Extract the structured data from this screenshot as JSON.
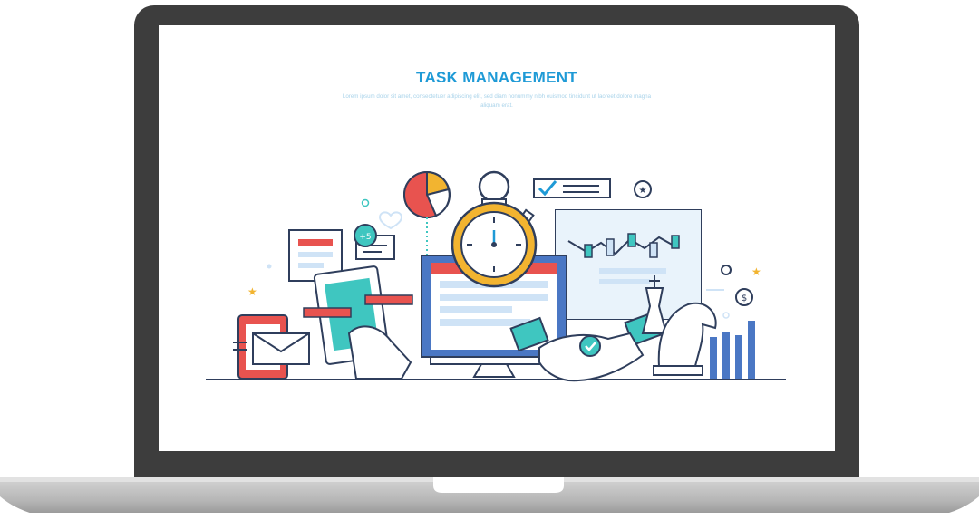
{
  "header": {
    "title": "TASK MANAGEMENT",
    "subtitle": "Lorem ipsum dolor sit amet, consectetuer adipiscing elit, sed diam nonummy nibh euismod tincidunt ut laoreet dolore magna aliquam erat."
  },
  "illustration": {
    "badge_text": "+5",
    "coin_symbol": "$",
    "icons": [
      "laptop-icon",
      "pie-chart-icon",
      "stopwatch-icon",
      "checklist-icon",
      "star-icon",
      "document-icon",
      "chat-bubble-icon",
      "tablet-icon",
      "phone-icon",
      "envelope-icon",
      "monitor-icon",
      "stock-chart-icon",
      "handshake-icon",
      "chess-knight-icon",
      "chess-king-icon",
      "bar-chart-icon",
      "dollar-coin-icon",
      "heart-icon"
    ]
  },
  "colors": {
    "bezel": "#3d3d3d",
    "base": "#b8b8b8",
    "title": "#1e9ad6",
    "subtitle": "#a9d3ea",
    "navy": "#2f3e5c",
    "teal": "#3fc6c0",
    "blue": "#4a77c4",
    "red": "#e8534f",
    "yellow": "#f2b430",
    "light_blue": "#cfe3f6"
  }
}
